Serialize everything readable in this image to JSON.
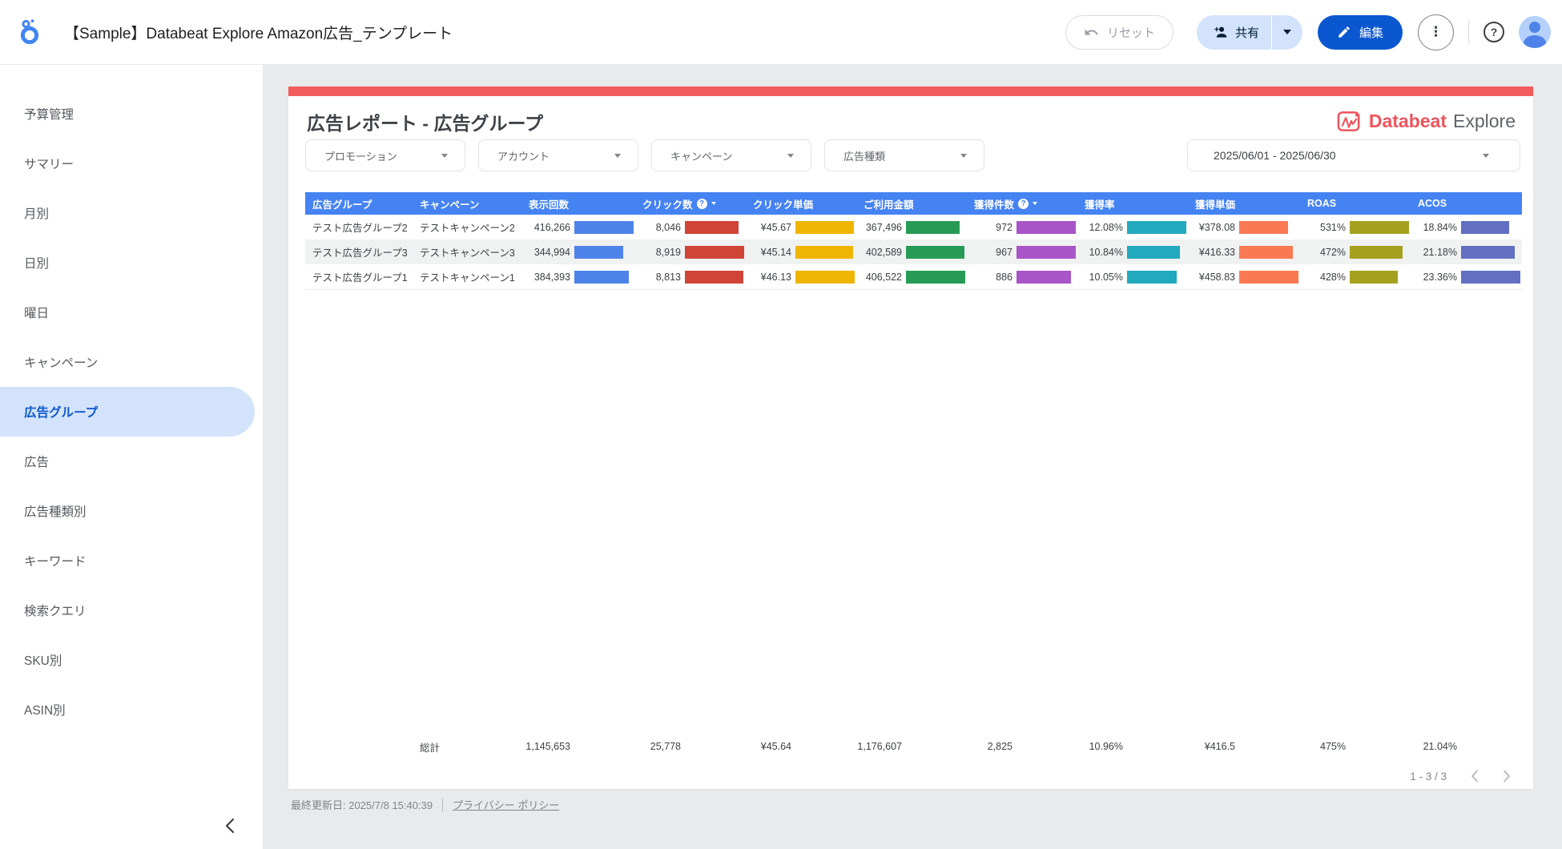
{
  "app_header": {
    "title": "【Sample】Databeat Explore Amazon広告_テンプレート",
    "reset_label": "リセット",
    "share_label": "共有",
    "edit_label": "編集",
    "more_icon": "⋮",
    "help_icon": "?"
  },
  "sidebar": {
    "items": [
      {
        "id": "budget",
        "label": "予算管理",
        "selected": false
      },
      {
        "id": "summary",
        "label": "サマリー",
        "selected": false
      },
      {
        "id": "monthly",
        "label": "月別",
        "selected": false
      },
      {
        "id": "daily",
        "label": "日別",
        "selected": false
      },
      {
        "id": "weekday",
        "label": "曜日",
        "selected": false
      },
      {
        "id": "campaign",
        "label": "キャンペーン",
        "selected": false
      },
      {
        "id": "ad-group",
        "label": "広告グループ",
        "selected": true
      },
      {
        "id": "ad",
        "label": "広告",
        "selected": false
      },
      {
        "id": "ad-type",
        "label": "広告種類別",
        "selected": false
      },
      {
        "id": "keyword",
        "label": "キーワード",
        "selected": false
      },
      {
        "id": "search-query",
        "label": "検索クエリ",
        "selected": false
      },
      {
        "id": "sku",
        "label": "SKU別",
        "selected": false
      },
      {
        "id": "asin",
        "label": "ASIN別",
        "selected": false
      }
    ]
  },
  "report": {
    "title": "広告レポート - 広告グループ",
    "brand": {
      "name": "Databeat",
      "suffix": "Explore"
    },
    "filters": [
      {
        "id": "promotion",
        "label": "プロモーション"
      },
      {
        "id": "account",
        "label": "アカウント"
      },
      {
        "id": "campaign",
        "label": "キャンペーン"
      },
      {
        "id": "ad-type",
        "label": "広告種類"
      }
    ],
    "date_range": "2025/06/01 - 2025/06/30",
    "pagination": {
      "range": "1 - 3 / 3"
    }
  },
  "footer": {
    "last_updated": "最終更新日: 2025/7/8 15:40:39",
    "privacy_link": "プライバシー ポリシー"
  },
  "colors": {
    "header_blue": "#4583f3",
    "accent_red": "#f25b5b",
    "selected_nav": "#d3e3fc",
    "edit_button": "#0b57d0",
    "share_button": "#d3e3fc"
  },
  "chart_data": {
    "type": "table",
    "title": "広告レポート - 広告グループ",
    "columns": [
      {
        "key": "ad_group",
        "label": "広告グループ",
        "type": "dimension"
      },
      {
        "key": "campaign",
        "label": "キャンペーン",
        "type": "dimension"
      },
      {
        "key": "impressions",
        "label": "表示回数",
        "type": "metric",
        "bar_color": "#4e83ea"
      },
      {
        "key": "clicks",
        "label": "クリック数",
        "type": "metric",
        "bar_color": "#cf4437",
        "info": true,
        "sort": true
      },
      {
        "key": "cpc",
        "label": "クリック単価",
        "type": "metric",
        "bar_color": "#efb500"
      },
      {
        "key": "cost",
        "label": "ご利用金額",
        "type": "metric",
        "bar_color": "#279b56"
      },
      {
        "key": "conversions",
        "label": "獲得件数",
        "type": "metric",
        "bar_color": "#a855c8",
        "info": true,
        "sort": true
      },
      {
        "key": "cvr",
        "label": "獲得率",
        "type": "metric",
        "bar_color": "#22a9bd"
      },
      {
        "key": "cpa",
        "label": "獲得単価",
        "type": "metric",
        "bar_color": "#f97a52"
      },
      {
        "key": "roas",
        "label": "ROAS",
        "type": "metric",
        "bar_color": "#a5a11f"
      },
      {
        "key": "acos",
        "label": "ACOS",
        "type": "metric",
        "bar_color": "#6170c2"
      }
    ],
    "rows": [
      {
        "ad_group": "テスト広告グループ2",
        "campaign": "テストキャンペーン2",
        "cells": [
          {
            "text": "416,266",
            "value": 416266
          },
          {
            "text": "8,046",
            "value": 8046
          },
          {
            "text": "¥45.67",
            "value": 45.67
          },
          {
            "text": "367,496",
            "value": 367496
          },
          {
            "text": "972",
            "value": 972
          },
          {
            "text": "12.08%",
            "value": 12.08
          },
          {
            "text": "¥378.08",
            "value": 378.08
          },
          {
            "text": "531%",
            "value": 531
          },
          {
            "text": "18.84%",
            "value": 18.84
          }
        ]
      },
      {
        "ad_group": "テスト広告グループ3",
        "campaign": "テストキャンペーン3",
        "cells": [
          {
            "text": "344,994",
            "value": 344994
          },
          {
            "text": "8,919",
            "value": 8919
          },
          {
            "text": "¥45.14",
            "value": 45.14
          },
          {
            "text": "402,589",
            "value": 402589
          },
          {
            "text": "967",
            "value": 967
          },
          {
            "text": "10.84%",
            "value": 10.84
          },
          {
            "text": "¥416.33",
            "value": 416.33
          },
          {
            "text": "472%",
            "value": 472
          },
          {
            "text": "21.18%",
            "value": 21.18
          }
        ]
      },
      {
        "ad_group": "テスト広告グループ1",
        "campaign": "テストキャンペーン1",
        "cells": [
          {
            "text": "384,393",
            "value": 384393
          },
          {
            "text": "8,813",
            "value": 8813
          },
          {
            "text": "¥46.13",
            "value": 46.13
          },
          {
            "text": "406,522",
            "value": 406522
          },
          {
            "text": "886",
            "value": 886
          },
          {
            "text": "10.05%",
            "value": 10.05
          },
          {
            "text": "¥458.83",
            "value": 458.83
          },
          {
            "text": "428%",
            "value": 428
          },
          {
            "text": "23.36%",
            "value": 23.36
          }
        ]
      }
    ],
    "totals": {
      "label": "総計",
      "values": [
        "1,145,653",
        "25,778",
        "¥45.64",
        "1,176,607",
        "2,825",
        "10.96%",
        "¥416.5",
        "475%",
        "21.04%"
      ]
    }
  }
}
